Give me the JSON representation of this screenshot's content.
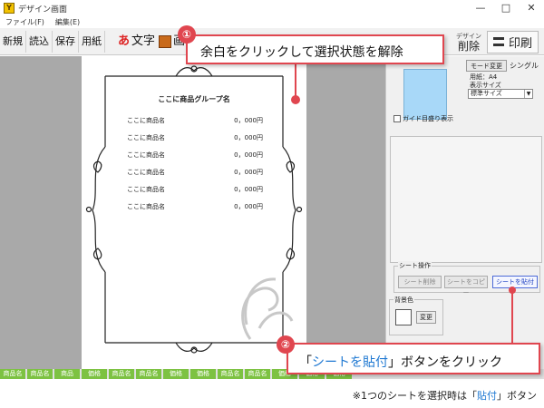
{
  "window": {
    "title": "デザイン画面",
    "app_icon": "app-logo-icon",
    "controls": [
      "—",
      "□",
      "✕"
    ]
  },
  "menu": [
    "ファイル(F)",
    "編集(E)"
  ],
  "toolbar": {
    "buttons": [
      "新規",
      "読込",
      "保存",
      "用紙"
    ],
    "text_glyph": "あ",
    "text_label": "文字",
    "image_label": "画",
    "delete_small": "デザイン",
    "delete_label": "削除",
    "print_label": "印刷"
  },
  "paper": {
    "group_title": "ここに商品グループ名",
    "rows": [
      {
        "name": "ここに商品名",
        "price": "0，000円"
      },
      {
        "name": "ここに商品名",
        "price": "0，000円"
      },
      {
        "name": "ここに商品名",
        "price": "0，000円"
      },
      {
        "name": "ここに商品名",
        "price": "0，000円"
      },
      {
        "name": "ここに商品名",
        "price": "0，000円"
      },
      {
        "name": "ここに商品名",
        "price": "0，000円"
      }
    ]
  },
  "panel": {
    "mode_button": "モード変更",
    "mode_label": "シングル",
    "paper_label": "用紙：A4",
    "size_label": "表示サイズ",
    "size_value": "標準サイズ",
    "guide_label": "ガイド目盛り表示",
    "sheet_group_label": "シート操作",
    "sheet_buttons": [
      "シート削除",
      "シートをコピー",
      "シートを貼付"
    ],
    "bg_label": "背景色",
    "bg_button": "変更"
  },
  "tabs": [
    "商品名",
    "商品名",
    "商品",
    "価格",
    "商品名",
    "商品名",
    "価格",
    "価格",
    "商品名",
    "商品名",
    "価格",
    "価格",
    "価格"
  ],
  "callout1": {
    "number": "①",
    "text": "余白をクリックして選択状態を解除"
  },
  "callout2": {
    "number": "②",
    "prefix": "「",
    "accent": "シートを貼付",
    "suffix": "」ボタンをクリック"
  },
  "note": {
    "prefix": "※1つのシートを選択時は「",
    "accent": "貼付",
    "suffix": "」ボタン"
  },
  "colors": {
    "callout_red": "#e0464f",
    "accent_blue": "#1e78d2",
    "tab_green": "#7dc242",
    "canvas_gray": "#a9a9a9"
  }
}
